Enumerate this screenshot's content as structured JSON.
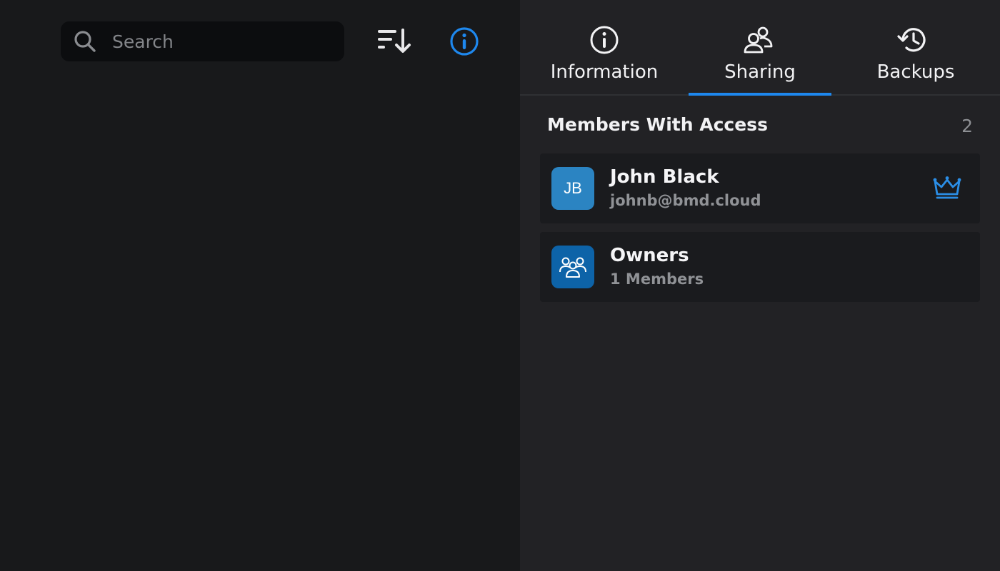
{
  "search": {
    "placeholder": "Search",
    "value": ""
  },
  "toolbar": {
    "sort_icon": "sort-descending-icon",
    "info_icon": "info-icon"
  },
  "tabs": [
    {
      "label": "Information",
      "icon": "info-circle-icon",
      "active": false
    },
    {
      "label": "Sharing",
      "icon": "users-icon",
      "active": true
    },
    {
      "label": "Backups",
      "icon": "history-icon",
      "active": false
    }
  ],
  "members_section": {
    "title": "Members With Access",
    "count": "2"
  },
  "members": [
    {
      "initials": "JB",
      "name": "John Black",
      "subtitle": "johnb@bmd.cloud",
      "badge_icon": "crown-icon"
    },
    {
      "icon": "group-icon",
      "name": "Owners",
      "subtitle": "1 Members"
    }
  ],
  "colors": {
    "accent": "#1e88ee",
    "left_background": "#18191b",
    "right_background": "#222225",
    "card_background": "#1a1b1e"
  }
}
